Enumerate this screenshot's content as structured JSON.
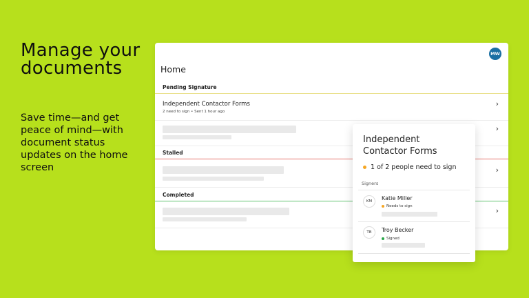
{
  "hero": {
    "headline": "Manage your documents",
    "subtext": "Save time—and get peace of mind—with document status updates on the home screen"
  },
  "app": {
    "user_initials": "MW",
    "title": "Home",
    "sections": {
      "pending": "Pending Signature",
      "stalled": "Stalled",
      "completed": "Completed"
    },
    "pending_item": {
      "title": "Independent Contactor Forms",
      "meta": "2 need to sign • Sent 1 hour ago"
    },
    "chevron": "›"
  },
  "popover": {
    "title": "Independent Contactor Forms",
    "status": "1 of 2 people need to sign",
    "signers_label": "Signers",
    "signers": [
      {
        "initials": "KM",
        "name": "Katie Miller",
        "status": "Needs to sign"
      },
      {
        "initials": "TB",
        "name": "Troy Becker",
        "status": "Signed"
      }
    ]
  },
  "colors": {
    "background": "#b7e01c",
    "avatar": "#1a6fa3",
    "pending_line": "#e9e08a",
    "stalled_line": "#e6726b",
    "completed_line": "#5fc16f",
    "needs_sign": "#f5a623",
    "signed": "#2aa84a"
  }
}
